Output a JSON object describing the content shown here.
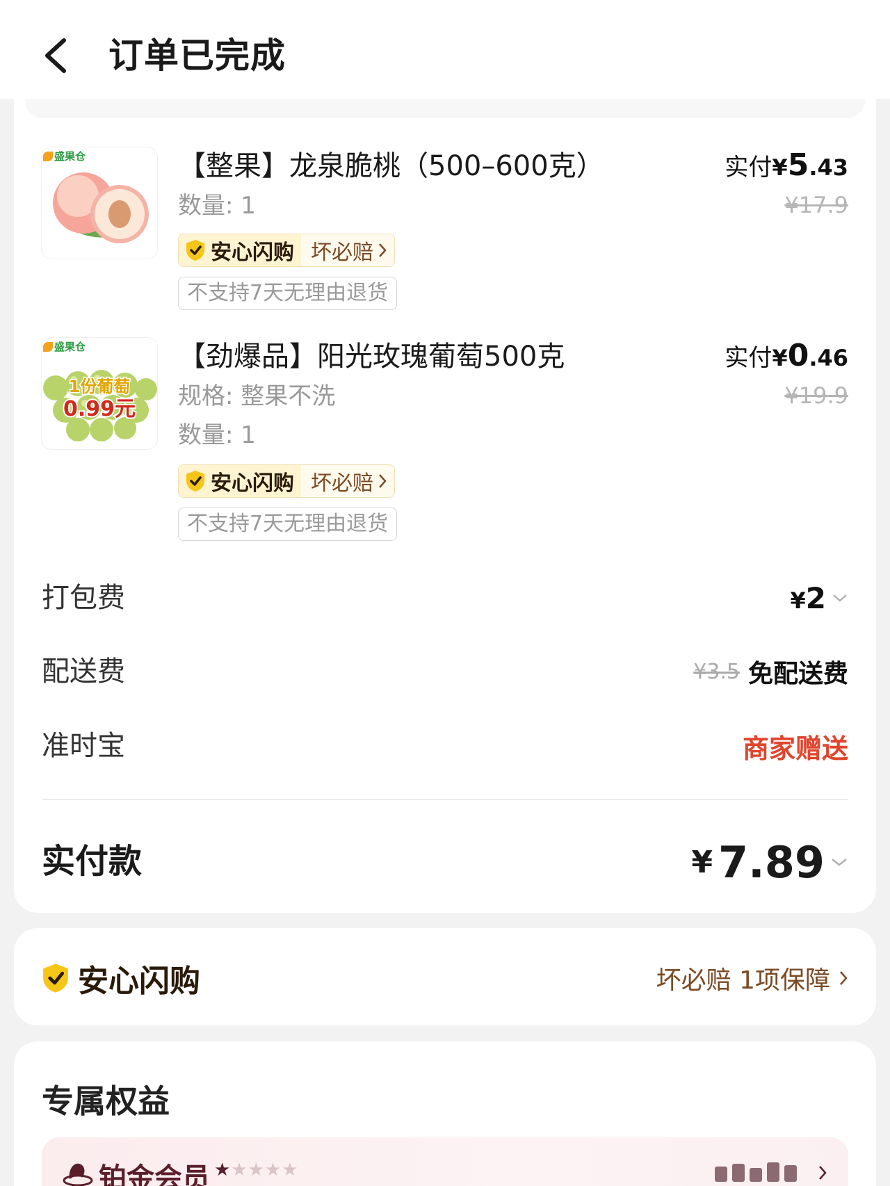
{
  "header": {
    "title": "订单已完成"
  },
  "products": [
    {
      "brand": "盛果仓",
      "name": "【整果】龙泉脆桃（500–600克）",
      "specs": [
        "数量: 1"
      ],
      "guard_badge": "安心闪购",
      "guard_link": "坏必赔",
      "return_policy": "不支持7天无理由退货",
      "paid_label": "实付",
      "paid_currency": "¥",
      "paid_int": "5",
      "paid_dec": ".43",
      "original_price": "¥17.9"
    },
    {
      "brand": "盛果仓",
      "image_text_1": "1份葡萄",
      "image_text_2": "0.99元",
      "name": "【劲爆品】阳光玫瑰葡萄500克",
      "specs": [
        "规格: 整果不洗",
        "数量: 1"
      ],
      "guard_badge": "安心闪购",
      "guard_link": "坏必赔",
      "return_policy": "不支持7天无理由退货",
      "paid_label": "实付",
      "paid_currency": "¥",
      "paid_int": "0",
      "paid_dec": ".46",
      "original_price": "¥19.9"
    }
  ],
  "fees": {
    "packing": {
      "label": "打包费",
      "currency": "¥",
      "amount": "2"
    },
    "delivery": {
      "label": "配送费",
      "original": "¥3.5",
      "value": "免配送费"
    },
    "ontime": {
      "label": "准时宝",
      "value": "商家赠送"
    }
  },
  "total": {
    "label": "实付款",
    "currency": "¥",
    "amount": "7.89"
  },
  "guarantee": {
    "title": "安心闪购",
    "link": "坏必赔 1项保障"
  },
  "benefits": {
    "title": "专属权益",
    "member_name": "铂金会员",
    "stars_filled": 1,
    "stars_total": 5
  },
  "colors": {
    "accent_red": "#e0452e",
    "guard_brown": "#7a4a24",
    "guard_gold": "#f5c518",
    "member_wine": "#5a1e2a"
  },
  "icons": {
    "back": "chevron-left-icon",
    "shield": "shield-check-icon",
    "member": "member-crest-icon"
  }
}
